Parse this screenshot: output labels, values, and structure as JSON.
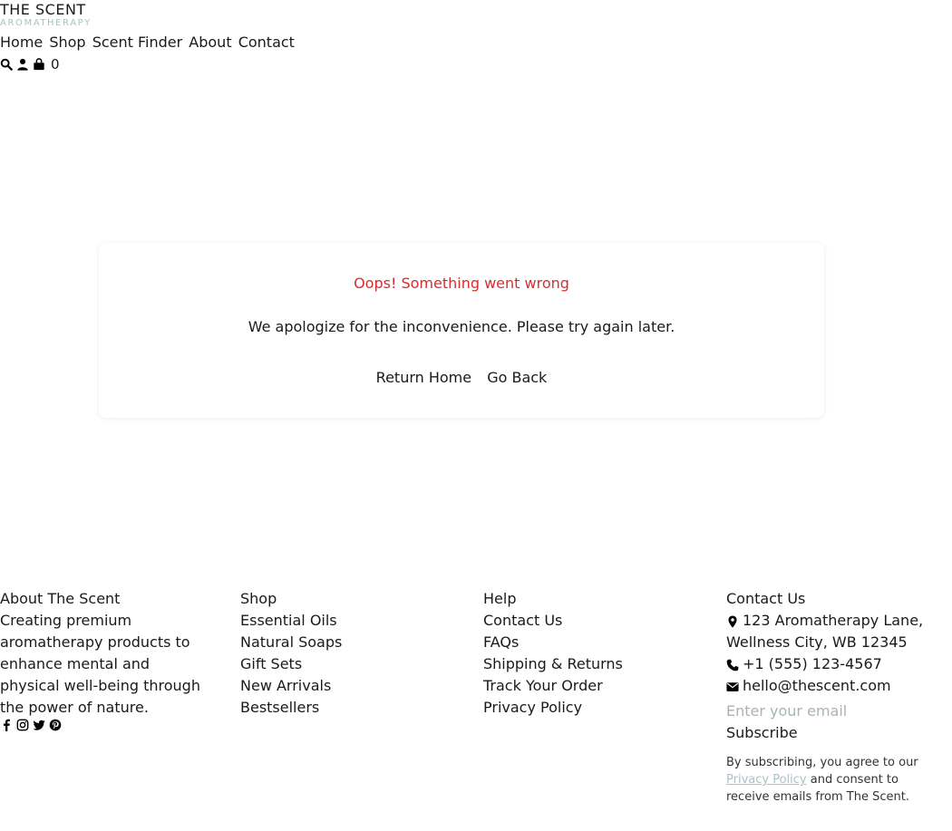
{
  "brand": {
    "title": "THE SCENT",
    "subtitle": "AROMATHERAPY"
  },
  "nav": {
    "items": [
      "Home",
      "Shop",
      "Scent Finder",
      "About",
      "Contact"
    ]
  },
  "header_actions": {
    "search_icon": "search-icon",
    "account_icon": "user-icon",
    "cart_icon": "shopping-bag-icon",
    "cart_count": "0"
  },
  "error": {
    "title": "Oops! Something went wrong",
    "message": "We apologize for the inconvenience. Please try again later.",
    "return_home": "Return Home",
    "go_back": "Go Back"
  },
  "footer": {
    "about": {
      "title": "About The Scent",
      "text": "Creating premium aromatherapy products to enhance mental and physical well-being through the power of nature.",
      "social_icons": [
        "facebook-icon",
        "instagram-icon",
        "twitter-icon",
        "pinterest-icon"
      ]
    },
    "shop": {
      "title": "Shop",
      "links": [
        "Essential Oils",
        "Natural Soaps",
        "Gift Sets",
        "New Arrivals",
        "Bestsellers"
      ]
    },
    "help": {
      "title": "Help",
      "links": [
        "Contact Us",
        "FAQs",
        "Shipping & Returns",
        "Track Your Order",
        "Privacy Policy"
      ]
    },
    "contact": {
      "title": "Contact Us",
      "address": "123 Aromatherapy Lane, Wellness City, WB 12345",
      "phone": "+1 (555) 123-4567",
      "email": "hello@thescent.com",
      "email_placeholder": "Enter your email",
      "subscribe_label": "Subscribe",
      "fine_before": "By subscribing, you agree to our",
      "fine_link": "Privacy Policy",
      "fine_after": "and consent to receive emails from The Scent."
    }
  },
  "colors": {
    "error": "#d32f2f",
    "accent": "#a9c2c6",
    "text": "#1a1a1a"
  }
}
